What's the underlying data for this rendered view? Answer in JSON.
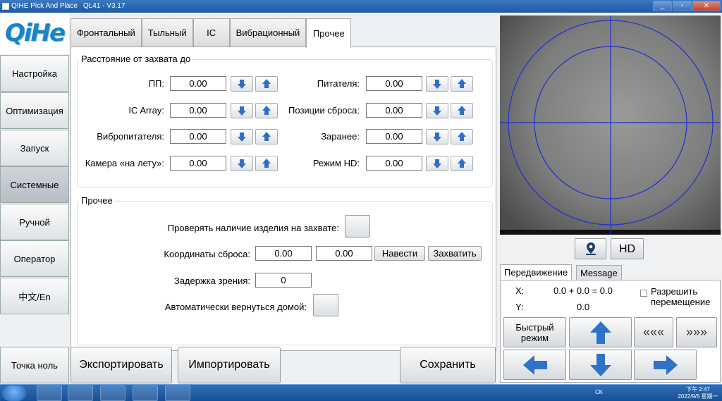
{
  "window": {
    "title": "QIHE Pick And Place",
    "version": "QL41 - V3.17",
    "buttons": [
      "_",
      "▫",
      "✕"
    ]
  },
  "logo": {
    "text": "QiHe"
  },
  "sidebar": {
    "items": [
      {
        "label": "Настройка"
      },
      {
        "label": "Оптимизация"
      },
      {
        "label": "Запуск"
      },
      {
        "label": "Системные"
      },
      {
        "label": "Ручной"
      },
      {
        "label": "Оператор"
      },
      {
        "label": "中文/En"
      }
    ],
    "zero_button": "Точка ноль"
  },
  "tabs": [
    "Фронтальный",
    "Тыльный",
    "IC",
    "Вибрационный",
    "Прочее"
  ],
  "distance_group": {
    "title": "Расстояние от захвата до",
    "left": [
      {
        "label": "ПП:",
        "value": "0.00"
      },
      {
        "label": "IC Array:",
        "value": "0.00"
      },
      {
        "label": "Вибропитателя:",
        "value": "0.00"
      },
      {
        "label": "Камера «на лету»:",
        "value": "0.00"
      }
    ],
    "right": [
      {
        "label": "Питателя:",
        "value": "0.00"
      },
      {
        "label": "Позиции сброса:",
        "value": "0.00"
      },
      {
        "label": "Заранее:",
        "value": "0.00"
      },
      {
        "label": "Режим HD:",
        "value": "0.00"
      }
    ]
  },
  "other_group": {
    "title": "Прочее",
    "check_part_label": "Проверять наличие изделия на захвате:",
    "drop_coords_label": "Координаты сброса:",
    "drop_x": "0.00",
    "drop_y": "0.00",
    "goto_label": "Навести",
    "capture_label": "Захватить",
    "vision_delay_label": "Задержка зрения:",
    "vision_delay_value": "0",
    "auto_home_label": "Автоматически вернуться домой:"
  },
  "bottom": {
    "export": "Экспортировать",
    "import": "Импортировать",
    "save": "Сохранить"
  },
  "camera": {
    "hd_label": "HD"
  },
  "move_panel": {
    "tabs": [
      "Передвижение",
      "Message"
    ],
    "x_label": "X:",
    "x_value": "0.0 + 0.0 = 0.0",
    "y_label": "Y:",
    "y_value": "0.0",
    "allow_move_label": "Разрешить перемещение",
    "fast_mode": "Быстрый режим",
    "rewind": "«««",
    "forward": "»»»"
  },
  "taskbar": {
    "lang": "CK",
    "time": "下午 2:47",
    "date": "2022/9/5 星期一"
  },
  "colors": {
    "accent": "#2f6fc6",
    "crosshair": "#1f2fd0",
    "logo": "#1b84c6"
  }
}
